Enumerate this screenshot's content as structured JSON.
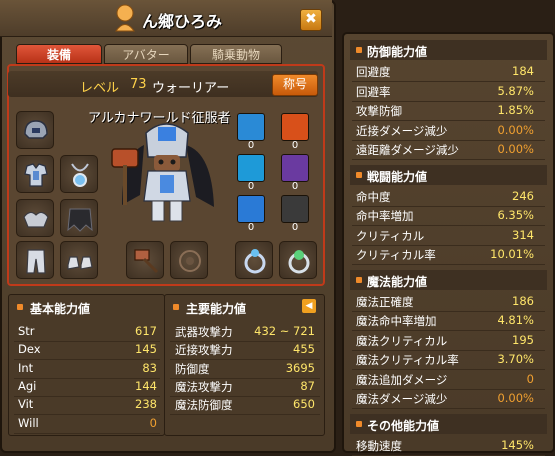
{
  "window": {
    "title": "ん鄉ひろみ",
    "close_symbol": "✖",
    "tabs": [
      "装備",
      "アバター",
      "騎乗動物"
    ]
  },
  "character": {
    "level_label": "レベル",
    "level": "73",
    "job": "ウォーリアー",
    "title_button": "称号",
    "title": "アルカナワールド征服者"
  },
  "equipment": {
    "left_slots": [
      "helmet-icon",
      "armor-top-icon",
      "pendant-icon",
      "shoulder-icon",
      "cape-icon",
      "pants-icon",
      "shoes-icon"
    ],
    "bottom_slots": [
      "hammer-weapon-icon",
      "emblem-icon",
      "ring-icon",
      "ring-gem-icon"
    ],
    "skills": [
      {
        "icon": "ice-slash-icon",
        "count": "0",
        "color": "#2a8ad6"
      },
      {
        "icon": "fire-icon",
        "count": "0",
        "color": "#d8501a"
      },
      {
        "icon": "water-icon",
        "count": "0",
        "color": "#1e9ad8"
      },
      {
        "icon": "skull-icon",
        "count": "0",
        "color": "#6a3aa0"
      },
      {
        "icon": "ice-shard-icon",
        "count": "0",
        "color": "#2a7ad6"
      },
      {
        "icon": "dark-orb-icon",
        "count": "0",
        "color": "#3a3a3a"
      }
    ]
  },
  "base_stats": {
    "header": "基本能力値",
    "rows": [
      {
        "label": "Str",
        "value": "617"
      },
      {
        "label": "Dex",
        "value": "145"
      },
      {
        "label": "Int",
        "value": "83"
      },
      {
        "label": "Agi",
        "value": "144"
      },
      {
        "label": "Vit",
        "value": "238"
      },
      {
        "label": "Will",
        "value": "0"
      }
    ]
  },
  "main_stats": {
    "header": "主要能力値",
    "toggle_symbol": "◀",
    "rows": [
      {
        "label": "武器攻撃力",
        "value": "432 ~ 721"
      },
      {
        "label": "近接攻撃力",
        "value": "455"
      },
      {
        "label": "防御度",
        "value": "3695"
      },
      {
        "label": "魔法攻撃力",
        "value": "87"
      },
      {
        "label": "魔法防御度",
        "value": "650"
      }
    ]
  },
  "side_panel": {
    "sections": [
      {
        "header": "防御能力値",
        "rows": [
          {
            "label": "回避度",
            "value": "184"
          },
          {
            "label": "回避率",
            "value": "5.87%"
          },
          {
            "label": "攻撃防御",
            "value": "1.85%"
          },
          {
            "label": "近接ダメージ減少",
            "value": "0.00%"
          },
          {
            "label": "遠距離ダメージ減少",
            "value": "0.00%"
          }
        ]
      },
      {
        "header": "戦闘能力値",
        "rows": [
          {
            "label": "命中度",
            "value": "246"
          },
          {
            "label": "命中率増加",
            "value": "6.35%"
          },
          {
            "label": "クリティカル",
            "value": "314"
          },
          {
            "label": "クリティカル率",
            "value": "10.01%"
          }
        ]
      },
      {
        "header": "魔法能力値",
        "rows": [
          {
            "label": "魔法正確度",
            "value": "186"
          },
          {
            "label": "魔法命中率増加",
            "value": "4.81%"
          },
          {
            "label": "魔法クリティカル",
            "value": "195"
          },
          {
            "label": "魔法クリティカル率",
            "value": "3.70%"
          },
          {
            "label": "魔法追加ダメージ",
            "value": "0"
          },
          {
            "label": "魔法ダメージ減少",
            "value": "0.00%"
          }
        ]
      },
      {
        "header": "その他能力値",
        "rows": [
          {
            "label": "移動速度",
            "value": "145%"
          }
        ]
      }
    ]
  }
}
